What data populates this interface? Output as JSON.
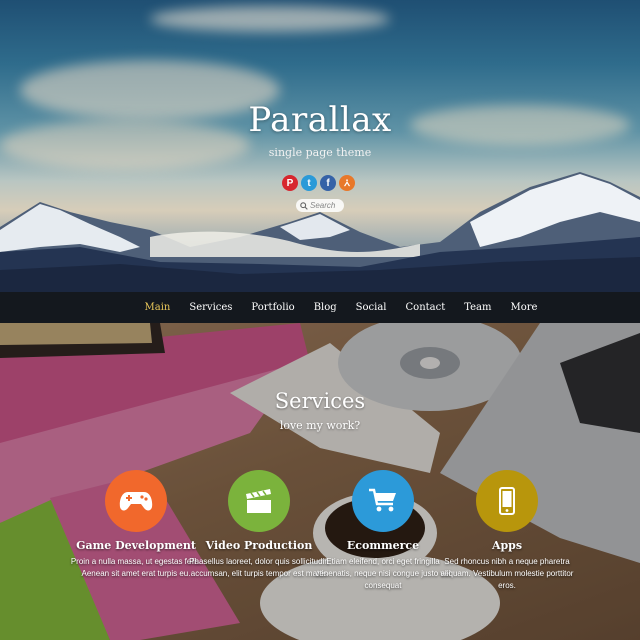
{
  "hero": {
    "title": "Parallax",
    "subtitle": "single page theme",
    "social": [
      {
        "icon": "pinterest-icon",
        "glyph": "P",
        "color": "#d7262e"
      },
      {
        "icon": "twitter-icon",
        "glyph": "t",
        "color": "#2a9ad8"
      },
      {
        "icon": "facebook-icon",
        "glyph": "f",
        "color": "#3562a7"
      },
      {
        "icon": "rss-icon",
        "glyph": ")",
        "color": "#e8782a"
      }
    ],
    "search_placeholder": "Search"
  },
  "nav": {
    "items": [
      "Main",
      "Services",
      "Portfolio",
      "Blog",
      "Social",
      "Contact",
      "Team",
      "More"
    ],
    "active_color": "#e8c65a"
  },
  "services": {
    "title": "Services",
    "subtitle": "love my work?",
    "items": [
      {
        "title": "Game Development",
        "icon": "gamepad-icon",
        "color": "#f1682c",
        "text": "Proin a nulla massa, ut egestas felis. Aenean sit amet erat turpis eu."
      },
      {
        "title": "Video Production",
        "icon": "clapperboard-icon",
        "color": "#7bb33c",
        "text": "Phasellus laoreet, dolor quis sollicitudin accumsan, elit turpis tempor est mattis"
      },
      {
        "title": "Ecommerce",
        "icon": "shopping-cart-icon",
        "color": "#2c9ad9",
        "text": "Etiam eleifend, orci eget fringilla venenatis, neque nisi congue justo vel consequat"
      },
      {
        "title": "Apps",
        "icon": "mobile-phone-icon",
        "color": "#b8960c",
        "text": "Sed rhoncus nibh a neque pharetra aliquam. Vestibulum molestie porttitor eros."
      }
    ]
  }
}
